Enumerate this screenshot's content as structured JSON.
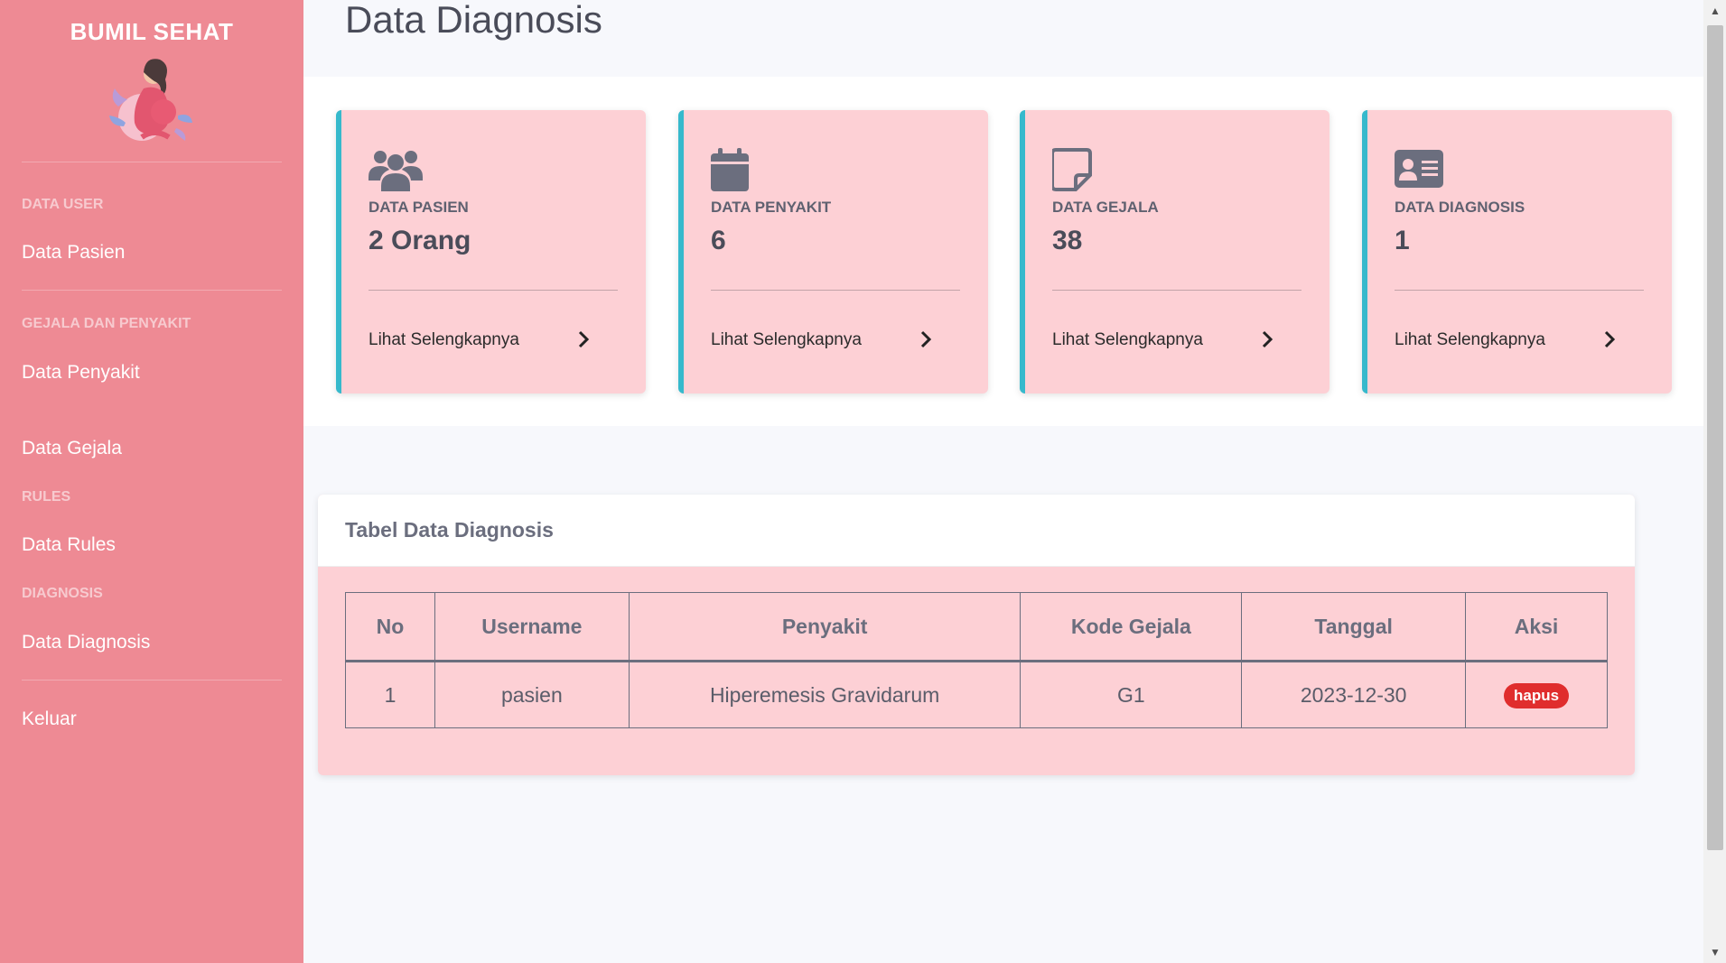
{
  "sidebar": {
    "brand": "BUMIL SEHAT",
    "sections": [
      {
        "heading": "DATA USER",
        "items": [
          "Data Pasien"
        ]
      },
      {
        "heading": "GEJALA DAN PENYAKIT",
        "items": [
          "Data Penyakit",
          "Data Gejala"
        ]
      },
      {
        "heading": "RULES",
        "items": [
          "Data Rules"
        ]
      },
      {
        "heading": "DIAGNOSIS",
        "items": [
          "Data Diagnosis"
        ]
      }
    ],
    "logout": "Keluar"
  },
  "page": {
    "title": "Data Diagnosis"
  },
  "cards": [
    {
      "icon": "users-icon",
      "label": "DATA PASIEN",
      "value": "2 Orang",
      "link": "Lihat Selengkapnya"
    },
    {
      "icon": "calendar-icon",
      "label": "DATA PENYAKIT",
      "value": "6",
      "link": "Lihat Selengkapnya"
    },
    {
      "icon": "note-icon",
      "label": "DATA GEJALA",
      "value": "38",
      "link": "Lihat Selengkapnya"
    },
    {
      "icon": "id-card-icon",
      "label": "DATA DIAGNOSIS",
      "value": "1",
      "link": "Lihat Selengkapnya"
    }
  ],
  "table": {
    "title": "Tabel Data Diagnosis",
    "columns": [
      "No",
      "Username",
      "Penyakit",
      "Kode Gejala",
      "Tanggal",
      "Aksi"
    ],
    "rows": [
      {
        "no": "1",
        "username": "pasien",
        "penyakit": "Hiperemesis Gravidarum",
        "kode_gejala": "G1",
        "tanggal": "2023-12-30",
        "aksi": "hapus"
      }
    ]
  },
  "colors": {
    "sidebar": "#ee8a94",
    "card": "#fdd0d5",
    "card_accent": "#36b9cc",
    "badge": "#e02d2d"
  }
}
